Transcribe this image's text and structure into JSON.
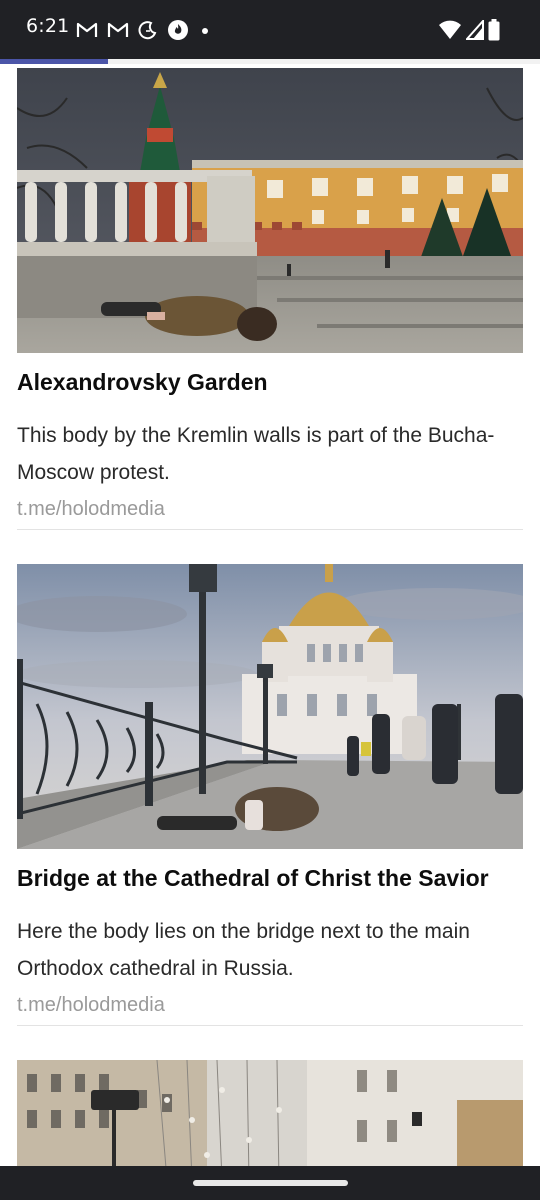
{
  "status_bar": {
    "time": "6:21",
    "icons": [
      "gmail-icon",
      "gmail-icon",
      "do-not-disturb-moon-icon",
      "fire-app-icon",
      "dot-icon",
      "wifi-icon",
      "cell-signal-icon",
      "battery-icon"
    ]
  },
  "reading_progress": 0.2,
  "articles": [
    {
      "title": "Alexandrovsky Garden",
      "text": "This body by the Kremlin walls is part of the Bucha-Moscow protest.",
      "source": "t.me/holodmedia",
      "photo": "photo-kremlin-wall"
    },
    {
      "title": "Bridge at the Cathedral of Christ the Savior",
      "text": "Here the body lies on the bridge next to the main Orthodox cathedral in Russia.",
      "source": "t.me/holodmedia",
      "photo": "photo-cathedral-bridge"
    },
    {
      "photo": "photo-moscow-street"
    }
  ],
  "colors": {
    "status_bar": "#202125",
    "progress": "#4b55a8",
    "source_text": "#9a9a9a"
  }
}
